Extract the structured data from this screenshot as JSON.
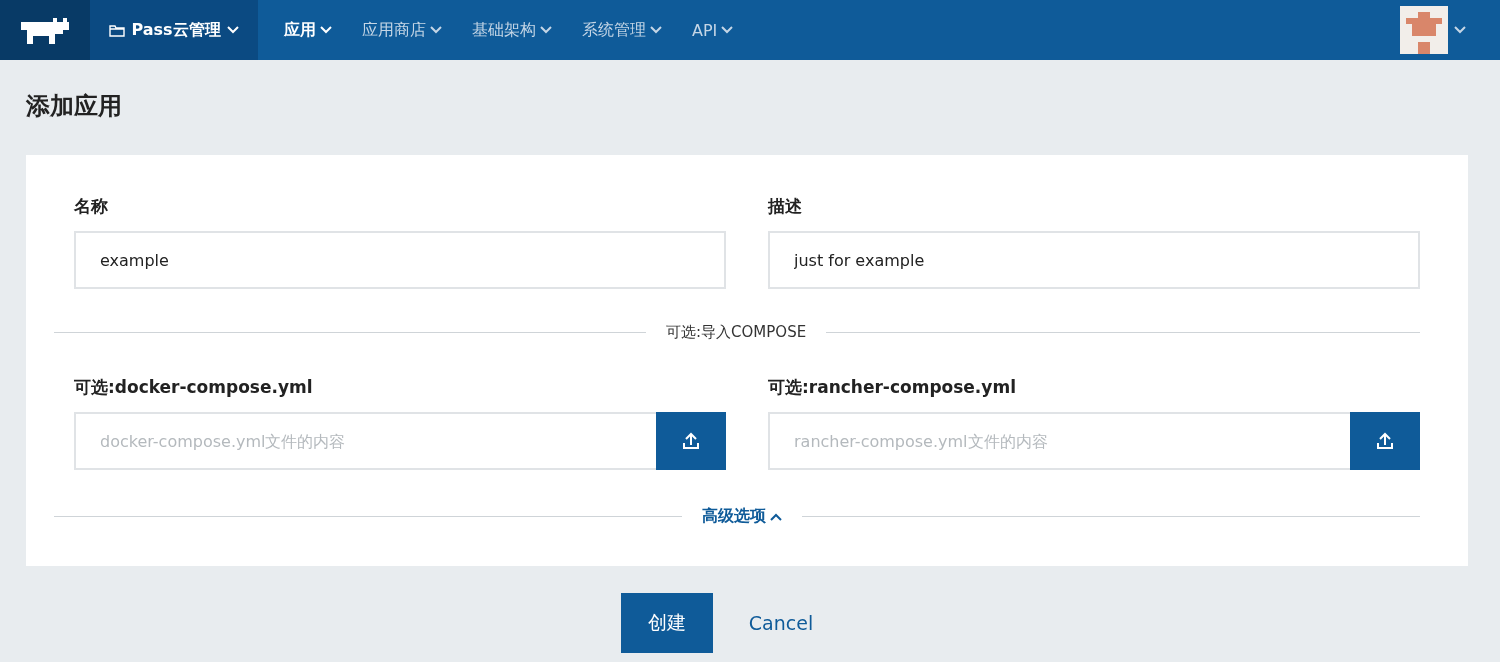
{
  "nav": {
    "environment": "Pass云管理",
    "items": [
      {
        "label": "应用",
        "selected": true
      },
      {
        "label": "应用商店",
        "selected": false
      },
      {
        "label": "基础架构",
        "selected": false
      },
      {
        "label": "系统管理",
        "selected": false
      },
      {
        "label": "API",
        "selected": false
      }
    ]
  },
  "page_title": "添加应用",
  "fields": [
    {
      "label": "名称",
      "value": "example"
    },
    {
      "label": "描述",
      "value": "just for example"
    }
  ],
  "compose_divider": "可选:导入COMPOSE",
  "compose_fields": [
    {
      "label": "可选:docker-compose.yml",
      "placeholder": "docker-compose.yml文件的内容"
    },
    {
      "label": "可选:rancher-compose.yml",
      "placeholder": "rancher-compose.yml文件的内容"
    }
  ],
  "advanced": {
    "label": "高级选项",
    "expanded": true
  },
  "buttons": {
    "create": "创建",
    "cancel": "Cancel"
  }
}
